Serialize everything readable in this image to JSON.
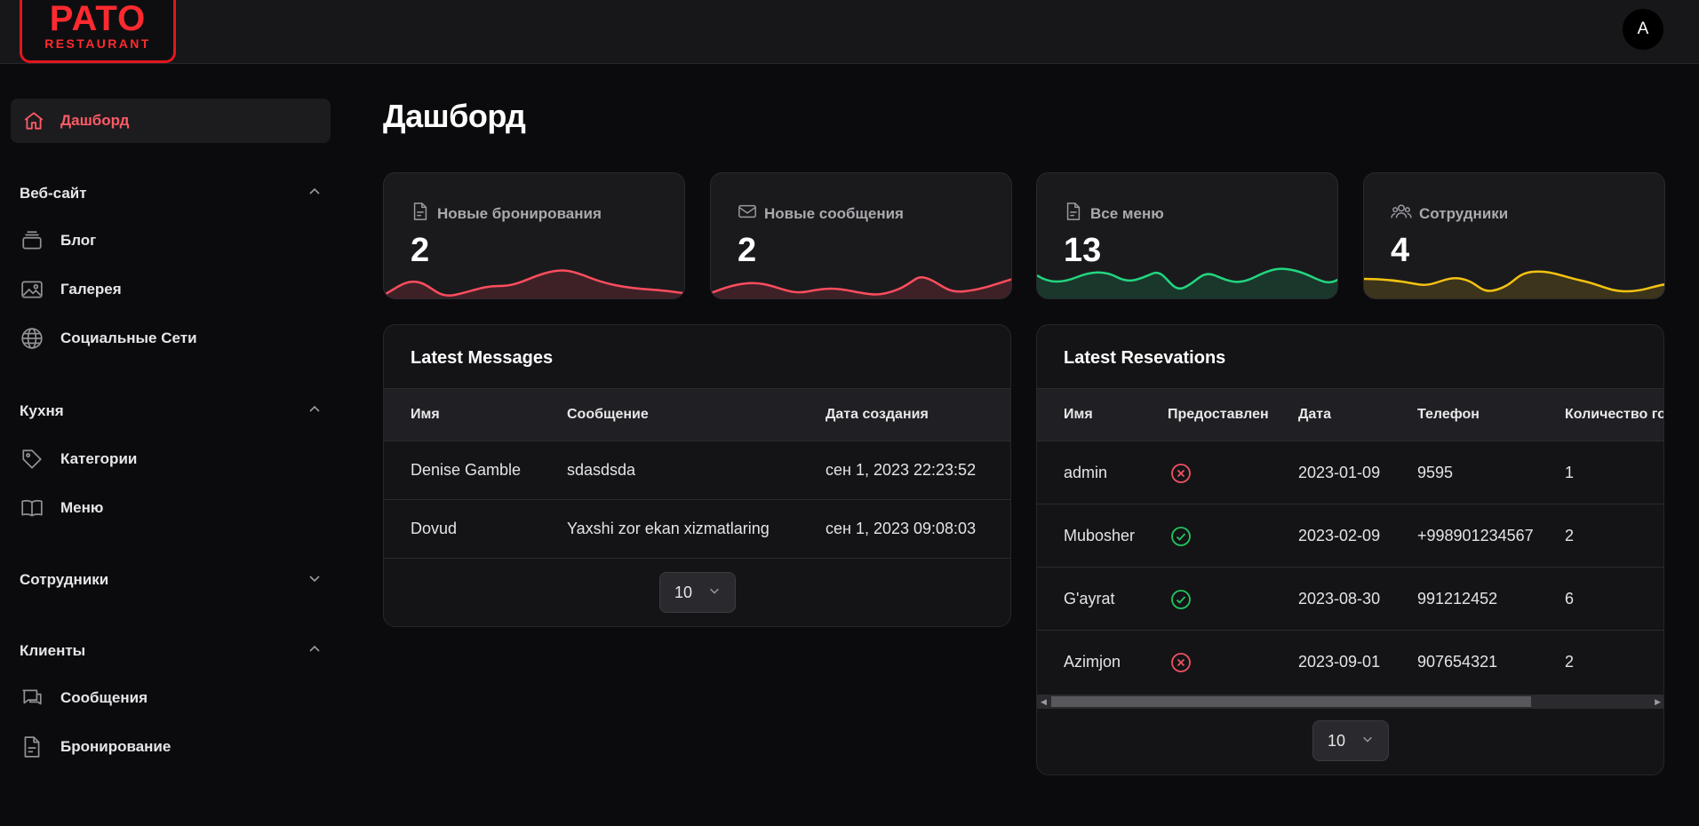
{
  "header": {
    "logo_main": "PATO",
    "logo_sub": "RESTAURANT",
    "avatar_letter": "A"
  },
  "sidebar": {
    "active": {
      "label": "Дашборд",
      "icon": "home-icon"
    },
    "sections": [
      {
        "title": "Веб-сайт",
        "expanded": true,
        "items": [
          {
            "label": "Блог",
            "icon": "blog-icon"
          },
          {
            "label": "Галерея",
            "icon": "image-icon"
          },
          {
            "label": "Социальные Сети",
            "icon": "globe-icon"
          }
        ]
      },
      {
        "title": "Кухня",
        "expanded": true,
        "items": [
          {
            "label": "Категории",
            "icon": "tag-icon"
          },
          {
            "label": "Меню",
            "icon": "book-icon"
          }
        ]
      },
      {
        "title": "Сотрудники",
        "expanded": false,
        "items": []
      },
      {
        "title": "Клиенты",
        "expanded": true,
        "items": [
          {
            "label": "Сообщения",
            "icon": "chat-icon"
          },
          {
            "label": "Бронирование",
            "icon": "document-icon"
          }
        ]
      }
    ]
  },
  "main": {
    "title": "Дашборд",
    "stats": [
      {
        "label": "Новые бронирования",
        "value": "2",
        "icon": "document-icon",
        "color": "#ff4d5e"
      },
      {
        "label": "Новые сообщения",
        "value": "2",
        "icon": "mail-icon",
        "color": "#ff4d5e"
      },
      {
        "label": "Все меню",
        "value": "13",
        "icon": "document-icon",
        "color": "#22d67f"
      },
      {
        "label": "Сотрудники",
        "value": "4",
        "icon": "users-icon",
        "color": "#f5c211"
      }
    ],
    "messages": {
      "title": "Latest Messages",
      "columns": [
        "Имя",
        "Сообщение",
        "Дата создания"
      ],
      "rows": [
        [
          "Denise Gamble",
          "sdasdsda",
          "сен 1, 2023 22:23:52"
        ],
        [
          "Dovud",
          "Yaxshi zor ekan xizmatlaring",
          "сен 1, 2023 09:08:03"
        ]
      ],
      "page_size": "10"
    },
    "reservations": {
      "title": "Latest Resevations",
      "columns": [
        "Имя",
        "Предоставлен",
        "Дата",
        "Телефон",
        "Количество го"
      ],
      "rows": [
        {
          "name": "admin",
          "provided": false,
          "date": "2023-01-09",
          "phone": "9595",
          "count": "1"
        },
        {
          "name": "Mubosher",
          "provided": true,
          "date": "2023-02-09",
          "phone": "+998901234567",
          "count": "2"
        },
        {
          "name": "G'ayrat",
          "provided": true,
          "date": "2023-08-30",
          "phone": "991212452",
          "count": "6"
        },
        {
          "name": "Azimjon",
          "provided": false,
          "date": "2023-09-01",
          "phone": "907654321",
          "count": "2"
        }
      ],
      "page_size": "10"
    }
  },
  "colors": {
    "accent": "#ff4d5e",
    "success": "#22c55e",
    "danger": "#f0515f"
  }
}
